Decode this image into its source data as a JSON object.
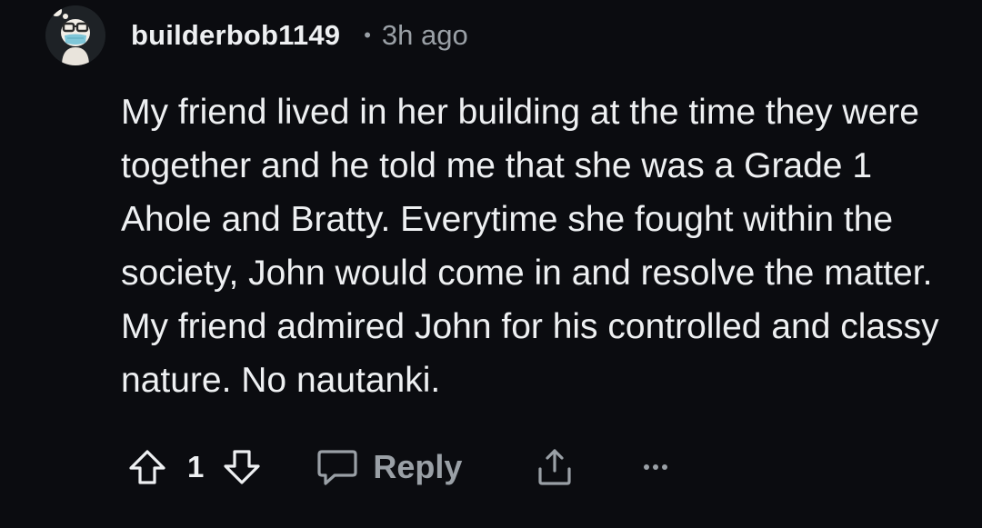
{
  "comment": {
    "author": {
      "username": "builderbob1149",
      "avatar_icon": "avatar-icon"
    },
    "separator": "•",
    "timestamp": "3h ago",
    "body": "My friend lived in her building at the time they were together and he told me that she was a Grade 1 Ahole and Bratty. Everytime she fought within the society, John would come in and resolve the matter. My friend admired John for his controlled and classy nature. No nautanki.",
    "actions": {
      "upvote_icon": "arrow-up-icon",
      "vote_count": "1",
      "downvote_icon": "arrow-down-icon",
      "reply_icon": "speech-bubble-icon",
      "reply_label": "Reply",
      "share_icon": "share-icon",
      "more_icon": "ellipsis-icon"
    }
  },
  "colors": {
    "background": "#0b0c10",
    "text_primary": "#eef0f2",
    "text_muted": "#9aa0a6",
    "avatar_bg": "#1e2226"
  }
}
